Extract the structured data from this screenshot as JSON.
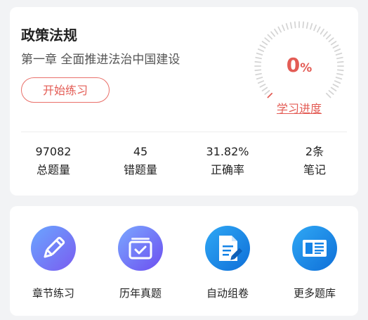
{
  "practice_card": {
    "subject_title": "政策法规",
    "chapter_title": "第一章 全面推进法治中国建设",
    "start_button_label": "开始练习",
    "progress": {
      "value": "0",
      "unit": "%",
      "percent": 0,
      "link_label": "学习进度"
    },
    "stats": [
      {
        "value": "97082",
        "label": "总题量"
      },
      {
        "value": "45",
        "label": "错题量"
      },
      {
        "value": "31.82%",
        "label": "正确率"
      },
      {
        "value": "2条",
        "label": "笔记"
      }
    ]
  },
  "shortcuts": [
    {
      "label": "章节练习",
      "icon": "pencil-icon"
    },
    {
      "label": "历年真题",
      "icon": "past-exams-icon"
    },
    {
      "label": "自动组卷",
      "icon": "auto-compose-paper-icon"
    },
    {
      "label": "更多题库",
      "icon": "newspaper-icon"
    }
  ],
  "colors": {
    "accent": "#e35c55",
    "dial_track": "#d5d5d5",
    "icon_purple": "#6f6df2",
    "icon_blue": "#1483e6"
  }
}
